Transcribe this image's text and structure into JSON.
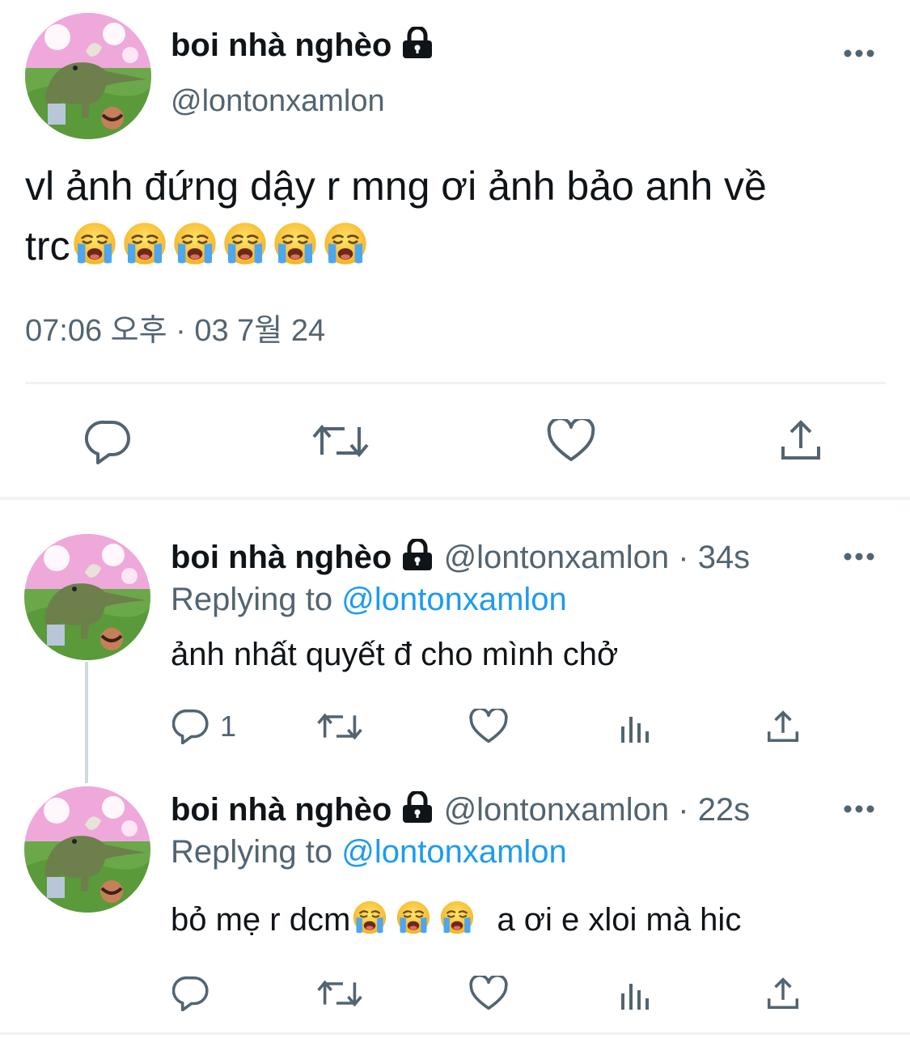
{
  "main_tweet": {
    "author_name": "boi nhà nghèo",
    "handle": "@lontonxamlon",
    "text": "vl ảnh đứng dậy r mng ơi ảnh bảo anh về",
    "text_line2": "trc",
    "emoji_count_note": "",
    "timestamp": "07:06 오후 · 03 7월 24",
    "actions": [
      "reply-icon",
      "retweet-icon",
      "like-icon",
      "share-icon"
    ]
  },
  "replies": [
    {
      "author_name": "boi nhà nghèo",
      "handle": "@lontonxamlon",
      "time": "34s",
      "separator": "·",
      "replying_label": "Replying to",
      "replying_to": "@lontonxamlon",
      "text": "ảnh nhất quyết đ cho mình chở",
      "reply_count": "1"
    },
    {
      "author_name": "boi nhà nghèo",
      "handle": "@lontonxamlon",
      "time": "22s",
      "separator": "·",
      "replying_label": "Replying to",
      "replying_to": "@lontonxamlon",
      "text_before": "bỏ mẹ r dcm",
      "text_after": "a ơi e xloi mà hic",
      "reply_count": ""
    }
  ],
  "colors": {
    "text": "#0f1419",
    "secondary": "#536471",
    "link": "#1d9bf0",
    "divider": "#eff3f4"
  }
}
